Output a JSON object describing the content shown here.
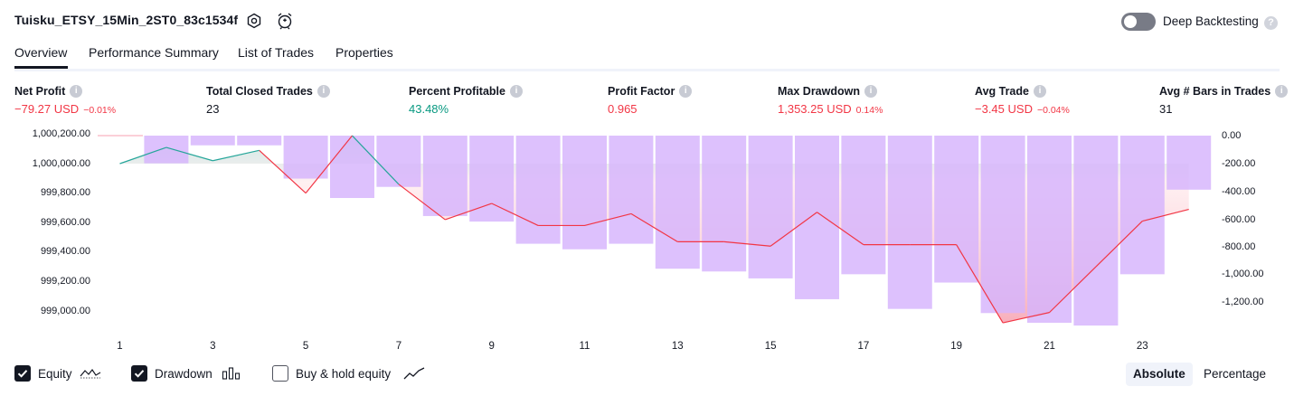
{
  "header": {
    "title": "Tuisku_ETSY_15Min_2ST0_83c1534f",
    "deep_backtesting_label": "Deep Backtesting",
    "deep_backtesting_enabled": false,
    "help_glyph": "?"
  },
  "tabs": [
    {
      "label": "Overview",
      "active": true
    },
    {
      "label": "Performance Summary",
      "active": false
    },
    {
      "label": "List of Trades",
      "active": false
    },
    {
      "label": "Properties",
      "active": false
    }
  ],
  "stats": [
    {
      "label": "Net Profit",
      "value": "−79.27 USD",
      "percent": "−0.01%",
      "tone": "neg"
    },
    {
      "label": "Total Closed Trades",
      "value": "23",
      "percent": "",
      "tone": "neutral"
    },
    {
      "label": "Percent Profitable",
      "value": "43.48%",
      "percent": "",
      "tone": "pos"
    },
    {
      "label": "Profit Factor",
      "value": "0.965",
      "percent": "",
      "tone": "neg"
    },
    {
      "label": "Max Drawdown",
      "value": "1,353.25 USD",
      "percent": "0.14%",
      "tone": "neg"
    },
    {
      "label": "Avg Trade",
      "value": "−3.45 USD",
      "percent": "−0.04%",
      "tone": "neg"
    },
    {
      "label": "Avg # Bars in Trades",
      "value": "31",
      "percent": "",
      "tone": "neutral"
    }
  ],
  "info_glyph": "i",
  "chart_data": {
    "type": "line+bar",
    "left_axis_ticks": [
      "1,000,200.00",
      "1,000,000.00",
      "999,800.00",
      "999,600.00",
      "999,400.00",
      "999,200.00",
      "999,000.00"
    ],
    "right_axis_ticks": [
      "0.00",
      "-200.00",
      "-400.00",
      "-600.00",
      "-800.00",
      "-1,000.00",
      "-1,200.00"
    ],
    "x_ticks": [
      "1",
      "3",
      "5",
      "7",
      "9",
      "11",
      "13",
      "15",
      "17",
      "19",
      "21",
      "23"
    ],
    "x": [
      1,
      2,
      3,
      4,
      5,
      6,
      7,
      8,
      9,
      10,
      11,
      12,
      13,
      14,
      15,
      16,
      17,
      18,
      19,
      20,
      21,
      22,
      23,
      24
    ],
    "series": [
      {
        "name": "Equity",
        "axis": "left",
        "values": [
          1000000,
          1000110,
          1000020,
          1000090,
          999800,
          1000190,
          999860,
          999620,
          999730,
          999580,
          999580,
          999660,
          999470,
          999470,
          999440,
          999670,
          999450,
          999450,
          999450,
          998920,
          998990,
          999300,
          999610,
          999690
        ]
      },
      {
        "name": "Drawdown",
        "axis": "right",
        "values": [
          0,
          -200,
          -70,
          -70,
          -310,
          -450,
          -370,
          -580,
          -620,
          -780,
          -820,
          -780,
          -960,
          -980,
          -1030,
          -1180,
          -1000,
          -1250,
          -1060,
          -1280,
          -1350,
          -1370,
          -1000,
          -390
        ]
      }
    ],
    "colors": {
      "equity_up": "#26a69a",
      "equity_down": "#f23645",
      "drawdown_bar": "#d6b3fd",
      "area_top": "#9dd7cf",
      "area_bottom": "#f7a1b0"
    }
  },
  "legend": [
    {
      "label": "Equity",
      "checked": true,
      "icon": "equity-line-icon"
    },
    {
      "label": "Drawdown",
      "checked": true,
      "icon": "drawdown-bars-icon"
    },
    {
      "label": "Buy & hold equity",
      "checked": false,
      "icon": "buyhold-line-icon"
    }
  ],
  "modes": [
    {
      "label": "Absolute",
      "active": true
    },
    {
      "label": "Percentage",
      "active": false
    }
  ]
}
